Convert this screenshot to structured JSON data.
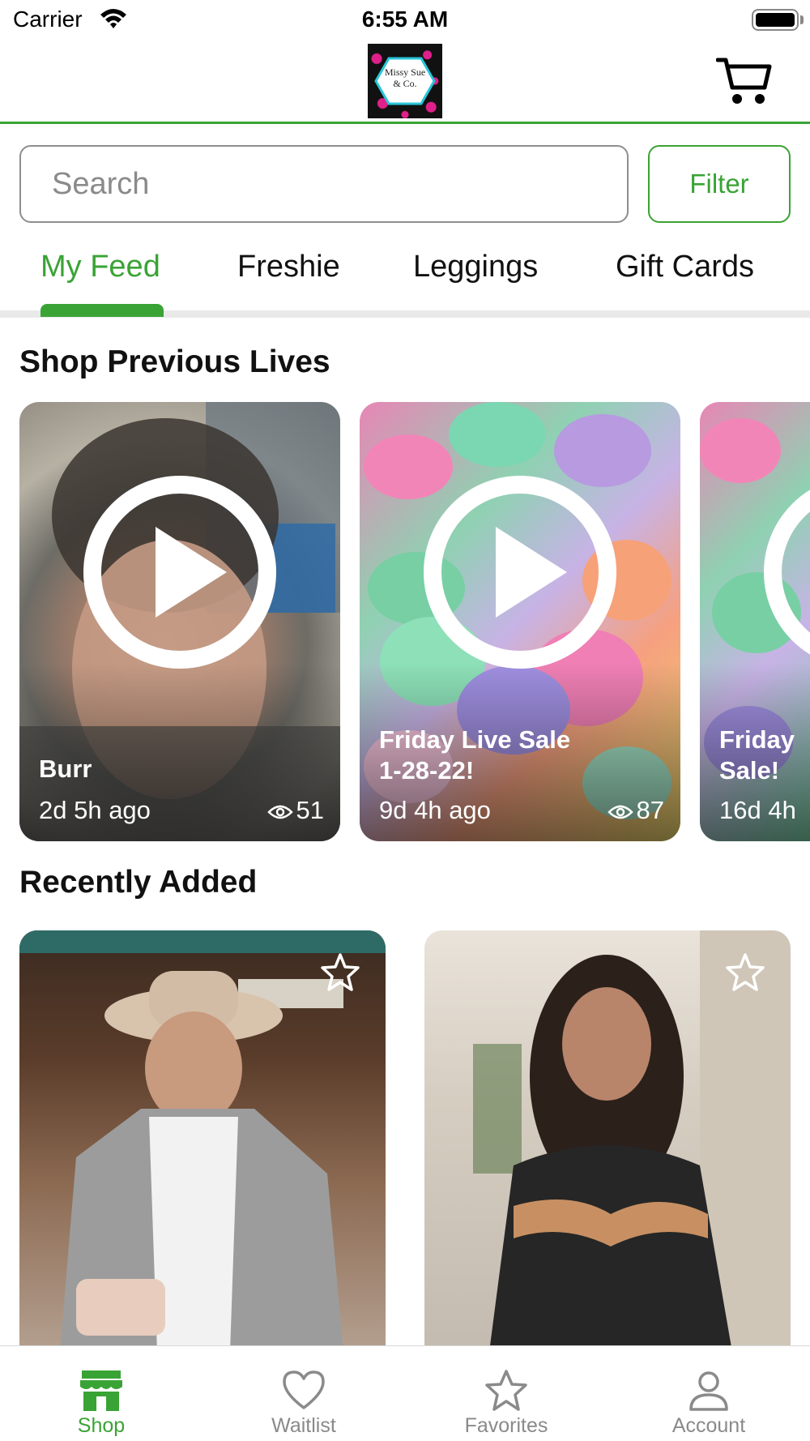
{
  "status_bar": {
    "carrier": "Carrier",
    "time": "6:55 AM"
  },
  "header": {
    "logo_text_line1": "Missy Sue",
    "logo_text_line2": "& Co.",
    "cart_icon": "cart-icon"
  },
  "search": {
    "placeholder": "Search",
    "filter_label": "Filter"
  },
  "tabs": [
    {
      "label": "My Feed",
      "active": true
    },
    {
      "label": "Freshie"
    },
    {
      "label": "Leggings"
    },
    {
      "label": "Gift Cards"
    }
  ],
  "previous_lives": {
    "title": "Shop Previous Lives",
    "items": [
      {
        "title_line1": "Burr",
        "title_line2": "",
        "time": "2d 5h ago",
        "views": "51"
      },
      {
        "title_line1": "Friday Live Sale",
        "title_line2": "1-28-22!",
        "time": "9d 4h ago",
        "views": "87"
      },
      {
        "title_line1": "Friday",
        "title_line2": "Sale!",
        "time": "16d 4h",
        "views": ""
      }
    ]
  },
  "recently_added": {
    "title": "Recently Added"
  },
  "tab_bar": [
    {
      "label": "Shop",
      "icon": "store-icon",
      "active": true
    },
    {
      "label": "Waitlist",
      "icon": "heart-icon"
    },
    {
      "label": "Favorites",
      "icon": "star-icon"
    },
    {
      "label": "Account",
      "icon": "person-icon"
    }
  ],
  "colors": {
    "accent": "#3aa335",
    "inactive": "#8a8a8a"
  }
}
